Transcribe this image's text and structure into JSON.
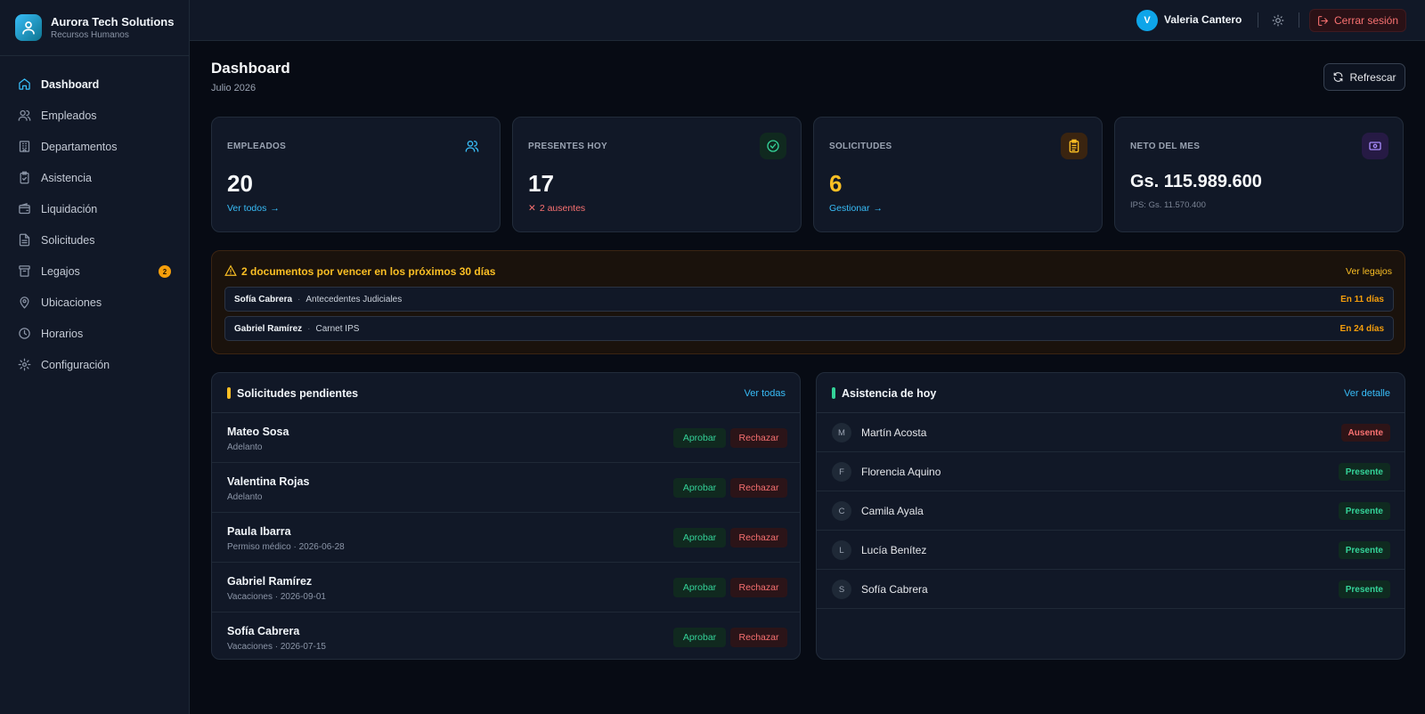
{
  "brand": {
    "name": "Aurora Tech Solutions",
    "subtitle": "Recursos Humanos"
  },
  "sidebar": {
    "items": [
      {
        "label": "Dashboard",
        "icon": "home-icon",
        "active": true
      },
      {
        "label": "Empleados",
        "icon": "users-icon"
      },
      {
        "label": "Departamentos",
        "icon": "building-icon"
      },
      {
        "label": "Asistencia",
        "icon": "clipboard-check-icon"
      },
      {
        "label": "Liquidación",
        "icon": "wallet-icon"
      },
      {
        "label": "Solicitudes",
        "icon": "file-text-icon"
      },
      {
        "label": "Legajos",
        "icon": "archive-icon",
        "badge": "2"
      },
      {
        "label": "Ubicaciones",
        "icon": "map-pin-icon"
      },
      {
        "label": "Horarios",
        "icon": "clock-icon"
      },
      {
        "label": "Configuración",
        "icon": "gear-icon"
      }
    ]
  },
  "topbar": {
    "user_initial": "V",
    "user_name": "Valeria Cantero",
    "logout_label": "Cerrar sesión"
  },
  "page": {
    "title": "Dashboard",
    "subtitle": "Julio 2026",
    "refresh_label": "Refrescar"
  },
  "stats": {
    "employees": {
      "label": "EMPLEADOS",
      "value": "20",
      "link": "Ver todos"
    },
    "present": {
      "label": "PRESENTES HOY",
      "value": "17",
      "note": "2 ausentes"
    },
    "requests": {
      "label": "SOLICITUDES",
      "value": "6",
      "link": "Gestionar"
    },
    "net": {
      "label": "NETO DEL MES",
      "value": "Gs. 115.989.600",
      "note": "IPS: Gs. 11.570.400"
    }
  },
  "alert": {
    "title": "2 documentos por vencer en los próximos 30 días",
    "link": "Ver legajos",
    "docs": [
      {
        "name": "Sofía Cabrera",
        "type": "Antecedentes Judiciales",
        "due": "En 11 días"
      },
      {
        "name": "Gabriel Ramírez",
        "type": "Carnet IPS",
        "due": "En 24 días"
      }
    ]
  },
  "pending": {
    "title": "Solicitudes pendientes",
    "link": "Ver todas",
    "approve_label": "Aprobar",
    "reject_label": "Rechazar",
    "rows": [
      {
        "name": "Mateo Sosa",
        "detail": "Adelanto"
      },
      {
        "name": "Valentina Rojas",
        "detail": "Adelanto"
      },
      {
        "name": "Paula Ibarra",
        "detail": "Permiso médico · 2026-06-28"
      },
      {
        "name": "Gabriel Ramírez",
        "detail": "Vacaciones · 2026-09-01"
      },
      {
        "name": "Sofía Cabrera",
        "detail": "Vacaciones · 2026-07-15"
      }
    ]
  },
  "attendance": {
    "title": "Asistencia de hoy",
    "link": "Ver detalle",
    "rows": [
      {
        "initial": "M",
        "name": "Martín Acosta",
        "status": "Ausente"
      },
      {
        "initial": "F",
        "name": "Florencia Aquino",
        "status": "Presente"
      },
      {
        "initial": "C",
        "name": "Camila Ayala",
        "status": "Presente"
      },
      {
        "initial": "L",
        "name": "Lucía Benítez",
        "status": "Presente"
      },
      {
        "initial": "S",
        "name": "Sofía Cabrera",
        "status": "Presente"
      }
    ]
  },
  "colors": {
    "accent": "#38bdf8",
    "amber": "#fbbf24",
    "success": "#34d399",
    "danger": "#f87171",
    "background": "#070b14",
    "panel": "#111827"
  }
}
